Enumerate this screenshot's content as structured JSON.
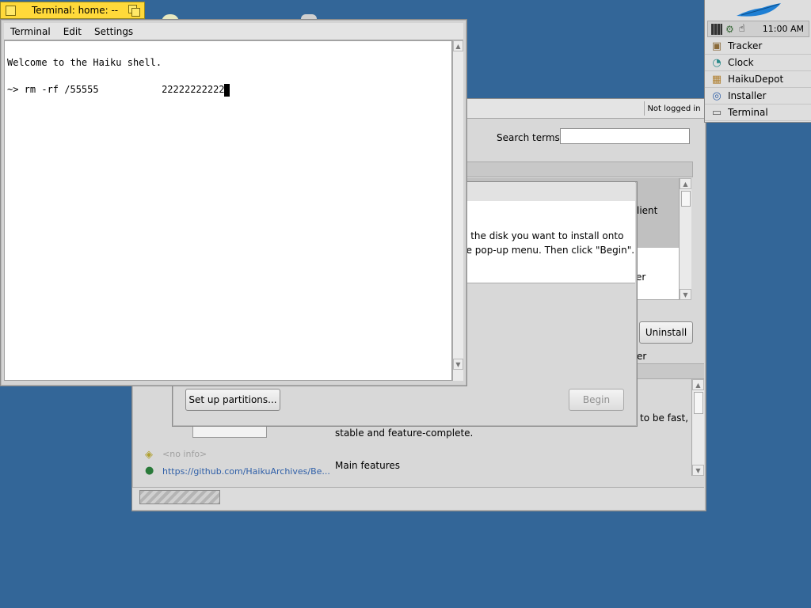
{
  "terminal": {
    "title": "Terminal: home: --",
    "menu": [
      "Terminal",
      "Edit",
      "Settings"
    ],
    "lines": [
      "Welcome to the Haiku shell.",
      "",
      "~> rm -rf /55555           22222222222"
    ]
  },
  "deskbar": {
    "clock": "11:00 AM",
    "items": [
      {
        "label": "Tracker",
        "icon": "tracker-icon"
      },
      {
        "label": "Clock",
        "icon": "clock-icon"
      },
      {
        "label": "HaikuDepot",
        "icon": "package-icon"
      },
      {
        "label": "Installer",
        "icon": "installer-icon"
      },
      {
        "label": "Terminal",
        "icon": "terminal-icon"
      }
    ]
  },
  "depot": {
    "login_status": "Not logged in",
    "search_label": "Search terms:",
    "search_value": "",
    "list_fragment_1": "lient",
    "list_fragment_2": "er",
    "uninstall_button": "Uninstall",
    "description_1": "to be fast,",
    "description_2": "stable and feature-complete.",
    "main_features": "Main features",
    "no_info": "<no info>",
    "homepage": "https://github.com/HaikuArchives/Be..."
  },
  "installer": {
    "message_line1": "e the disk you want to install onto",
    "message_line2": "he pop-up menu. Then click \"Begin\".",
    "setup_partitions_button": "Set up partitions...",
    "begin_button": "Begin"
  },
  "colors": {
    "desktop": "#336698",
    "tab_yellow": "#ffd93a",
    "link_blue": "#3060a8"
  }
}
